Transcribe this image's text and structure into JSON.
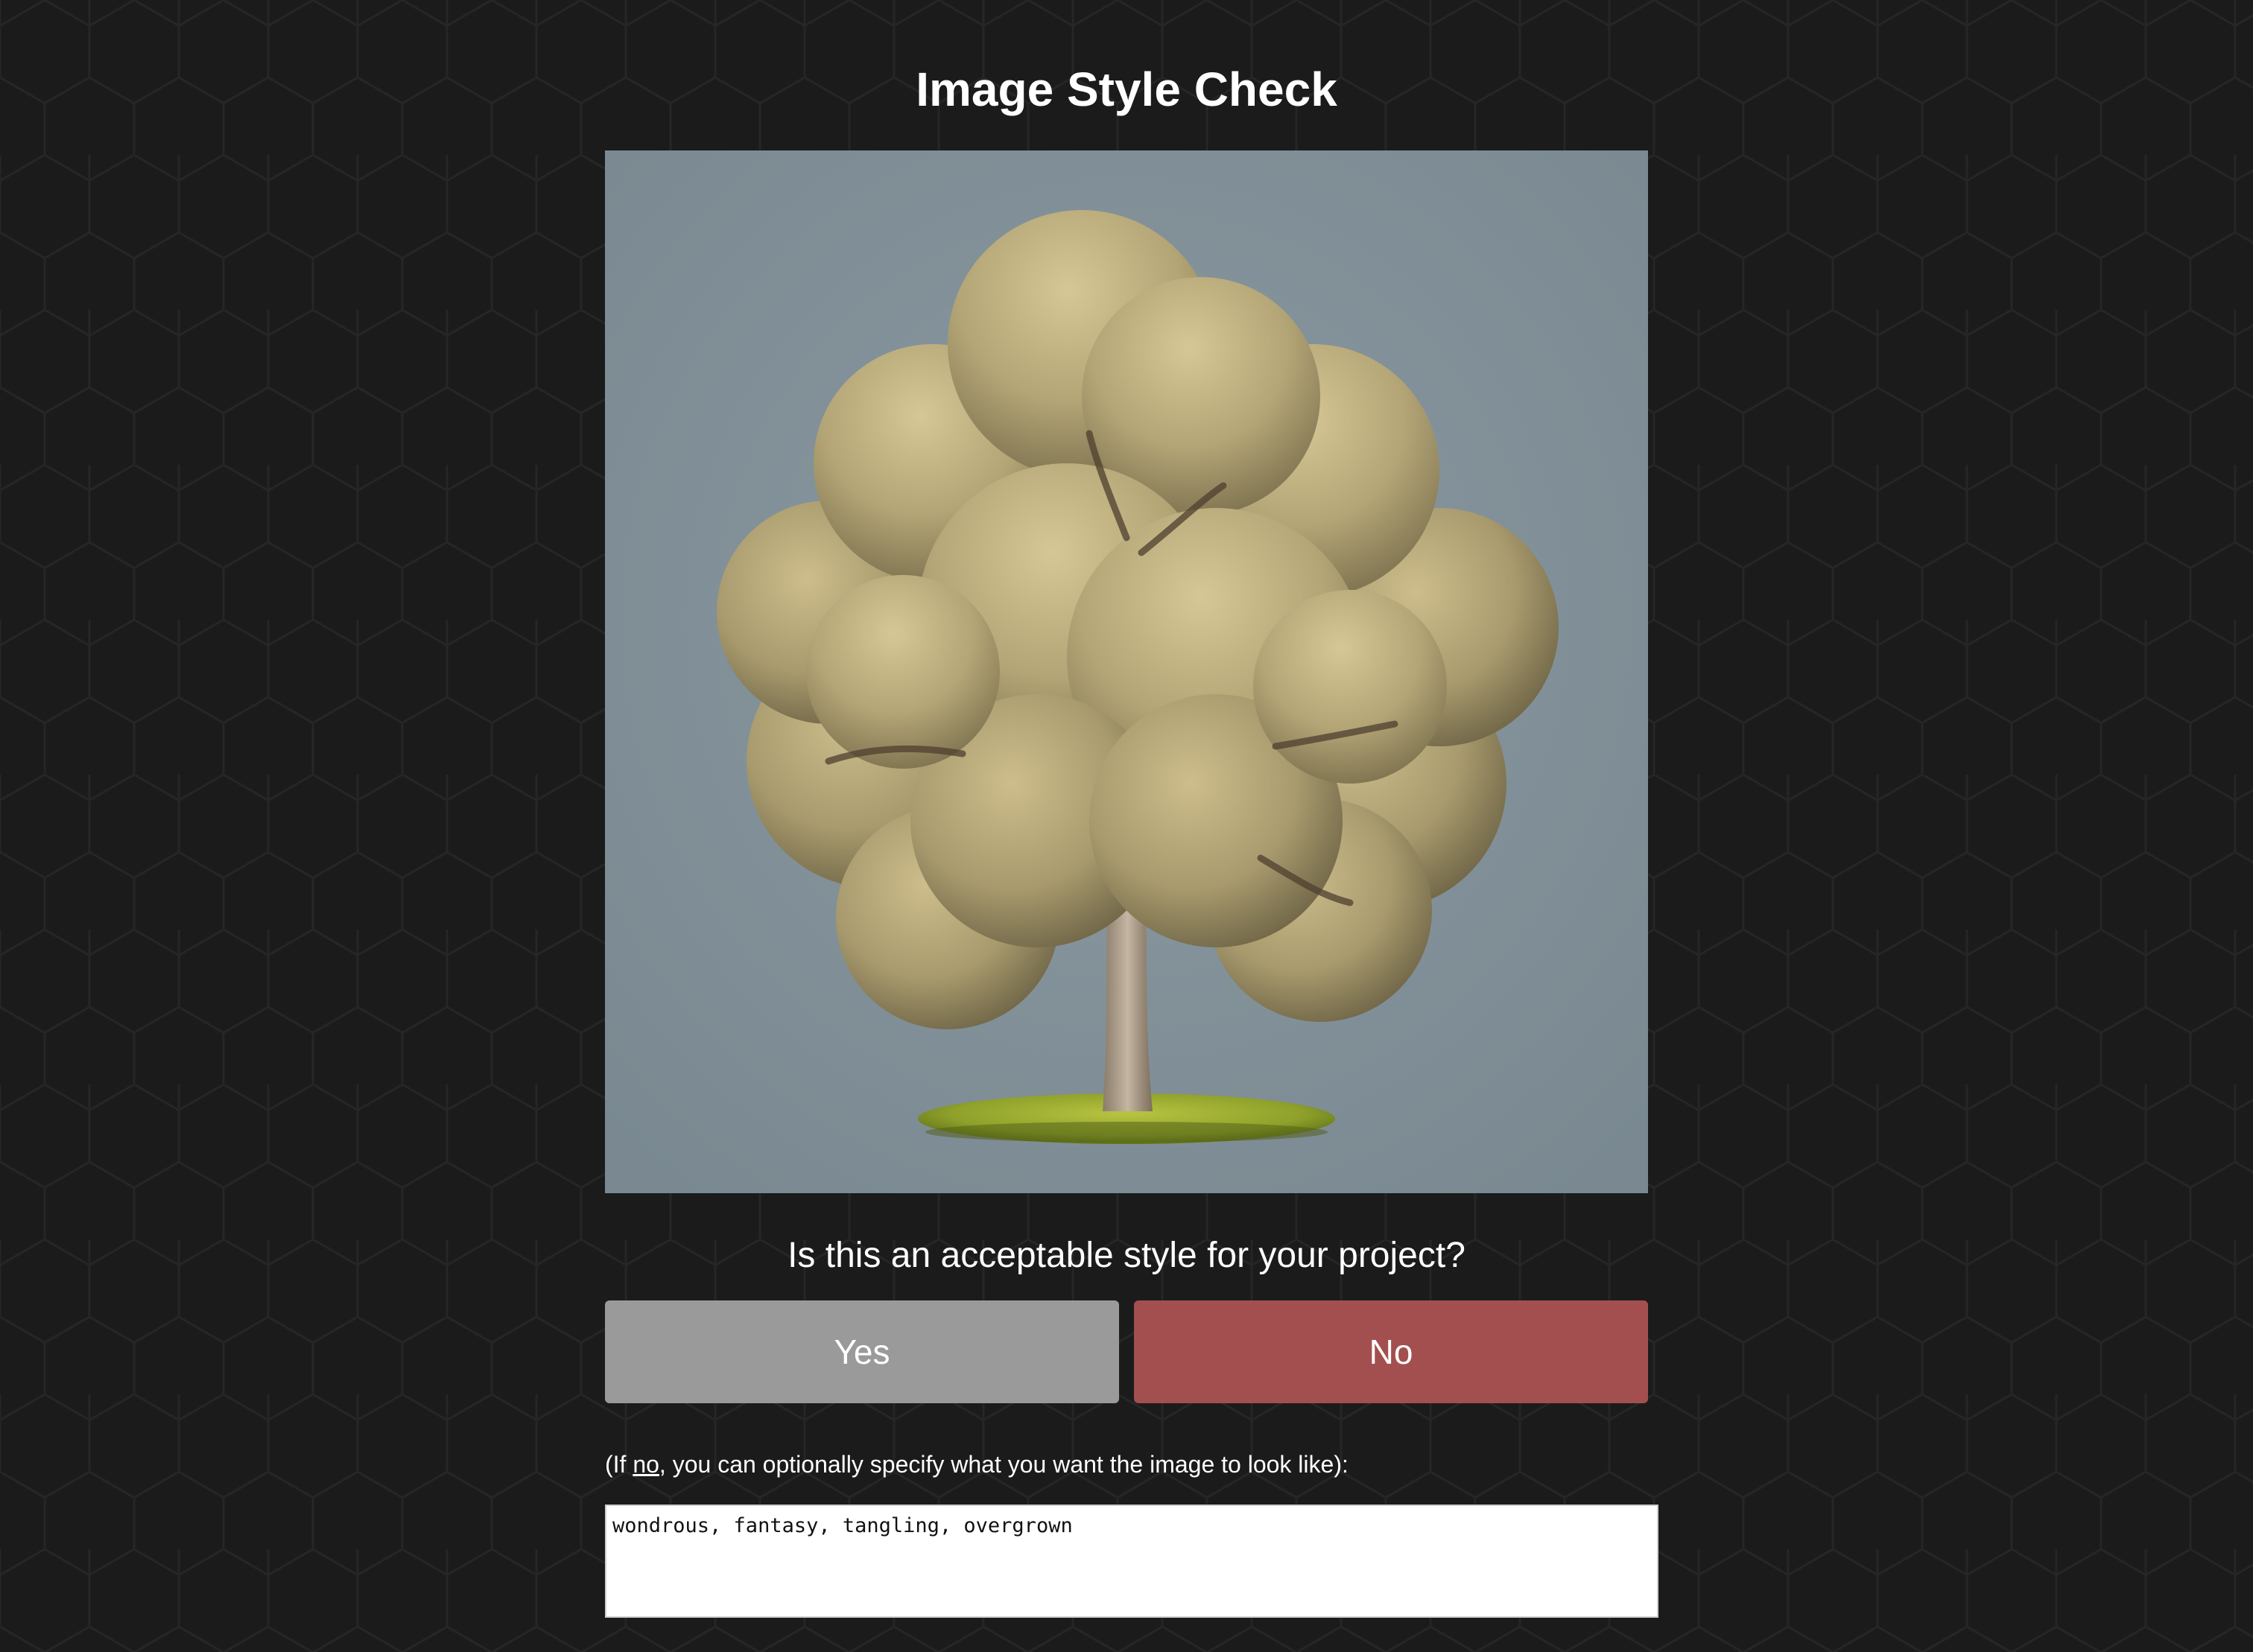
{
  "page": {
    "title": "Image Style Check"
  },
  "preview": {
    "icon": "generated-tree-image",
    "background_color": "#7f8e96"
  },
  "question": {
    "text": "Is this an acceptable style for your project?"
  },
  "buttons": {
    "yes_label": "Yes",
    "no_label": "No",
    "yes_color": "#9a9a9a",
    "no_color": "#a34f4f"
  },
  "feedback": {
    "hint_prefix": "(If ",
    "hint_emphasis": "no",
    "hint_suffix": ", you can optionally specify what you want the image to look like):",
    "value": "wondrous, fantasy, tangling, overgrown"
  },
  "theme": {
    "background": "#1b1b1c",
    "pattern": "hexagon-grid"
  }
}
